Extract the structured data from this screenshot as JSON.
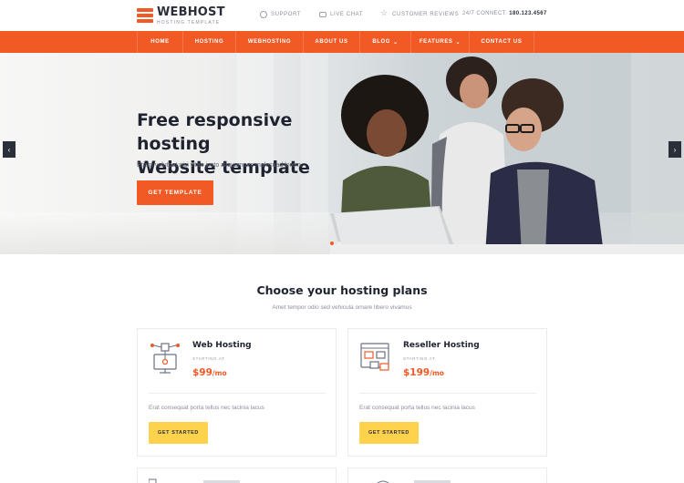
{
  "brand": {
    "name": "WEBHOST",
    "tagline": "HOSTING TEMPLATE",
    "accent": "#f15a24",
    "button_yellow": "#ffd24d"
  },
  "topbar": {
    "links": [
      {
        "label": "SUPPORT",
        "icon": "lifebuoy-icon"
      },
      {
        "label": "LIVE CHAT",
        "icon": "chat-icon"
      },
      {
        "label": "CUSTOMER REVIEWS",
        "icon": "star-icon"
      }
    ],
    "connect_label": "24/7 CONNECT:",
    "connect_phone": "180.123.4567"
  },
  "nav": {
    "items": [
      {
        "label": "HOME",
        "dropdown": false
      },
      {
        "label": "HOSTING",
        "dropdown": false
      },
      {
        "label": "WEBHOSTING",
        "dropdown": false
      },
      {
        "label": "ABOUT US",
        "dropdown": false
      },
      {
        "label": "BLOG",
        "dropdown": true
      },
      {
        "label": "FEATURES",
        "dropdown": true
      },
      {
        "label": "CONTACT US",
        "dropdown": false
      }
    ]
  },
  "hero": {
    "title_line1": "Free responsive hosting",
    "title_line2": "Website template",
    "subtitle": "Etiam volutpat nisi vitae justo aliquamnec malesuad lorem.",
    "cta": "GET TEMPLATE",
    "prev_icon": "chevron-left-icon",
    "next_icon": "chevron-right-icon"
  },
  "plans": {
    "title": "Choose your hosting plans",
    "subtitle": "Amet tempor odio sed vehicula ornare libero vivamus",
    "cards": [
      {
        "name": "Web Hosting",
        "starting_label": "STARTING AT",
        "price": "$99",
        "period": "/mo",
        "description": "Erat consequat porta tellus nec lacinia lacus",
        "button": "GET STARTED",
        "icon": "server-network-icon"
      },
      {
        "name": "Reseller Hosting",
        "starting_label": "STARTING AT",
        "price": "$199",
        "period": "/mo",
        "description": "Erat consequat porta tellus nec lacinia lacus",
        "button": "GET STARTED",
        "icon": "reseller-windows-icon"
      }
    ]
  }
}
